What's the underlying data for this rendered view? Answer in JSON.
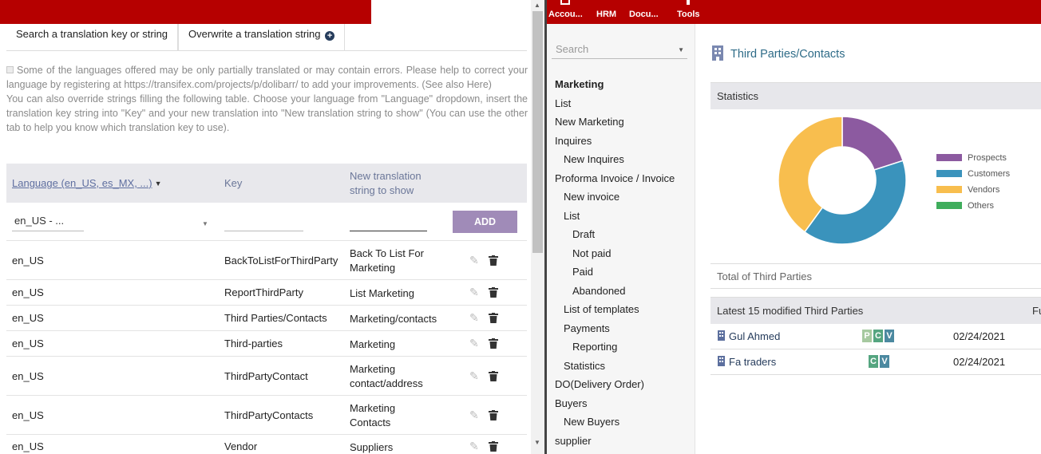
{
  "left": {
    "tabs": [
      "Search a translation key or string",
      "Overwrite a translation string"
    ],
    "info_lines": [
      "Some of the languages offered may be only partially translated or may contain errors. Please help to correct your language by registering at ",
      "https://transifex.com/projects/p/dolibarr/",
      " to add your improvements. (See also ",
      "Here",
      ")",
      "You can also override strings filling the following table. Choose your language from \"Language\" dropdown, insert the translation key string into \"Key\" and your new translation into \"New translation string to show\" (You can use the other tab to help you know which translation key to use)."
    ],
    "table": {
      "col_language": "Language (en_US, es_MX, ...)",
      "col_key": "Key",
      "col_new_line1": "New translation",
      "col_new_line2": "string to show",
      "language_selected": "en_US - ...",
      "key_value": "",
      "new_value": "",
      "add_label": "ADD",
      "rows": [
        {
          "lang": "en_US",
          "key": "BackToListForThirdParty",
          "value": [
            "Back To List For",
            "Marketing"
          ]
        },
        {
          "lang": "en_US",
          "key": "ReportThirdParty",
          "value": [
            "List Marketing"
          ]
        },
        {
          "lang": "en_US",
          "key": "Third Parties/Contacts",
          "value": [
            "Marketing/contacts"
          ]
        },
        {
          "lang": "en_US",
          "key": "Third-parties",
          "value": [
            "Marketing"
          ]
        },
        {
          "lang": "en_US",
          "key": "ThirdPartyContact",
          "value": [
            "Marketing",
            "contact/address"
          ]
        },
        {
          "lang": "en_US",
          "key": "ThirdPartyContacts",
          "value": [
            "Marketing",
            "Contacts"
          ]
        },
        {
          "lang": "en_US",
          "key": "Vendor",
          "value": [
            "Suppliers"
          ]
        }
      ]
    }
  },
  "right": {
    "nav": [
      "Accou...",
      "HRM",
      "Docu...",
      "Tools"
    ],
    "search_placeholder": "Search",
    "menu": [
      {
        "label": "Marketing",
        "level": "head"
      },
      {
        "label": "List",
        "level": "l0"
      },
      {
        "label": "New Marketing",
        "level": "l0"
      },
      {
        "label": "Inquires",
        "level": "l0"
      },
      {
        "label": "New Inquires",
        "level": "l1"
      },
      {
        "label": "Proforma Invoice / Invoice",
        "level": "l0"
      },
      {
        "label": "New invoice",
        "level": "l1"
      },
      {
        "label": "List",
        "level": "l1"
      },
      {
        "label": "Draft",
        "level": "l2"
      },
      {
        "label": "Not paid",
        "level": "l2"
      },
      {
        "label": "Paid",
        "level": "l2"
      },
      {
        "label": "Abandoned",
        "level": "l2"
      },
      {
        "label": "List of templates",
        "level": "l1"
      },
      {
        "label": "Payments",
        "level": "l1"
      },
      {
        "label": "Reporting",
        "level": "l2"
      },
      {
        "label": "Statistics",
        "level": "l1"
      },
      {
        "label": "DO(Delivery Order)",
        "level": "l0"
      },
      {
        "label": "Buyers",
        "level": "l0"
      },
      {
        "label": "New Buyers",
        "level": "l1"
      },
      {
        "label": "supplier",
        "level": "l0"
      }
    ],
    "page_title": "Third Parties/Contacts",
    "statistics_label": "Statistics",
    "total_label": "Total of Third Parties",
    "latest_label": "Latest 15 modified Third Parties",
    "latest_extra": "Fu",
    "latest_rows": [
      {
        "name": "Gul Ahmed",
        "tags": [
          "P",
          "C",
          "V"
        ],
        "date": "02/24/2021"
      },
      {
        "name": "Fa traders",
        "tags": [
          "C",
          "V"
        ],
        "date": "02/24/2021"
      }
    ],
    "tag_colors": {
      "P": "#a6c9a0",
      "C": "#55a580",
      "V": "#4c89a0"
    }
  },
  "chart_data": {
    "type": "pie",
    "categories": [
      "Prospects",
      "Customers",
      "Vendors",
      "Others"
    ],
    "values": [
      1,
      2,
      2,
      0
    ],
    "colors": [
      "#8c5aa0",
      "#3a93bc",
      "#f8be4e",
      "#3fad5c"
    ],
    "legend": "right"
  }
}
